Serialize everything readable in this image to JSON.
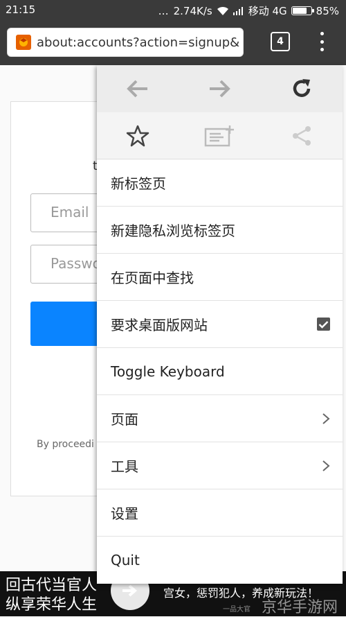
{
  "status_bar": {
    "time": "21:15",
    "network_speed": "2.74K/s",
    "carrier": "移动 4G",
    "battery": "85%",
    "battery_level": 0.85
  },
  "toolbar": {
    "url": "about:accounts?action=signup&",
    "tab_count": "4"
  },
  "page": {
    "title_fragment": "t",
    "email_placeholder": "Email",
    "password_placeholder": "Passwo",
    "legal_text": "By proceedi"
  },
  "menu": {
    "items": [
      {
        "label": "新标签页"
      },
      {
        "label": "新建隐私浏览标签页"
      },
      {
        "label": "在页面中查找"
      },
      {
        "label": "要求桌面版网站",
        "checked": true
      },
      {
        "label": "Toggle Keyboard"
      },
      {
        "label": "页面",
        "submenu": true
      },
      {
        "label": "工具",
        "submenu": true
      },
      {
        "label": "设置"
      },
      {
        "label": "Quit"
      }
    ]
  },
  "banner": {
    "line1": "回古代当官人",
    "line2": "纵享荣华人生",
    "line3": "宫女，惩罚犯人，养成新玩法！",
    "small": "一品大官",
    "watermark": "京华手游网"
  },
  "colors": {
    "toolbar": "#3a3a3a",
    "accent_blue": "#0a84ff",
    "firefox_orange": "#e66000"
  }
}
